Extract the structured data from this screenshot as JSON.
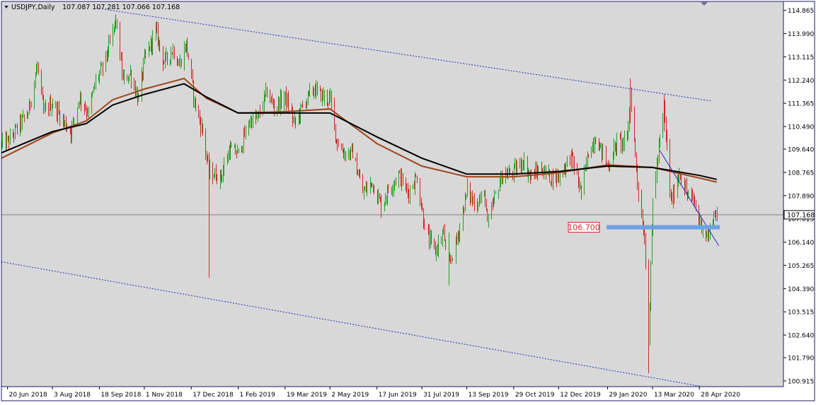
{
  "colors": {
    "background": "#d8d8d8",
    "axis_panel": "#ffffff",
    "frame": "#1b1b6b",
    "bull_candle": "#22a322",
    "bear_candle": "#d32626",
    "ma_black": "#000000",
    "ma_brown": "#a0461a",
    "channel_line": "#1f2fbf",
    "support_zone": "#6ea0e6",
    "current_price_line": "#808080",
    "price_tag_bg": "#ffffff",
    "price_label_text": "#d32626"
  },
  "chart_data": {
    "type": "candlestick",
    "title": "USDJPY,Daily",
    "ohlc_header": "107.087 107.281 107.066 107.168",
    "symbol": "USDJPY",
    "timeframe": "Daily",
    "ylim": [
      100.7,
      115.2
    ],
    "y_ticks": [
      "114.865",
      "113.990",
      "113.115",
      "112.240",
      "111.365",
      "110.490",
      "109.640",
      "108.765",
      "107.890",
      "107.015",
      "106.140",
      "105.265",
      "104.390",
      "103.515",
      "102.640",
      "101.790",
      "100.915"
    ],
    "x_ticks": [
      "20 Jun 2018",
      "3 Aug 2018",
      "18 Sep 2018",
      "1 Nov 2018",
      "17 Dec 2018",
      "1 Feb 2019",
      "19 Mar 2019",
      "2 May 2019",
      "17 Jun 2019",
      "31 Jul 2019",
      "13 Sep 2019",
      "29 Oct 2019",
      "12 Dec 2019",
      "29 Jan 2020",
      "13 Mar 2020",
      "28 Apr 2020"
    ],
    "x_tick_dates": [
      "2018-06-20",
      "2018-08-03",
      "2018-09-18",
      "2018-11-01",
      "2018-12-17",
      "2019-02-01",
      "2019-03-19",
      "2019-05-02",
      "2019-06-17",
      "2019-07-31",
      "2019-09-13",
      "2019-10-29",
      "2019-12-12",
      "2020-01-29",
      "2020-03-13",
      "2020-04-28"
    ],
    "current_price": 107.168,
    "current_price_label": "107.168",
    "support_level": 106.7,
    "support_label": "106.700",
    "price_path": [
      [
        "2018-06-14",
        109.8
      ],
      [
        "2018-06-22",
        110.0
      ],
      [
        "2018-07-02",
        110.6
      ],
      [
        "2018-07-10",
        111.0
      ],
      [
        "2018-07-19",
        112.8
      ],
      [
        "2018-07-25",
        111.0
      ],
      [
        "2018-08-03",
        111.4
      ],
      [
        "2018-08-13",
        110.7
      ],
      [
        "2018-08-21",
        110.3
      ],
      [
        "2018-08-29",
        111.6
      ],
      [
        "2018-09-07",
        111.0
      ],
      [
        "2018-09-14",
        112.2
      ],
      [
        "2018-09-21",
        112.7
      ],
      [
        "2018-09-28",
        113.6
      ],
      [
        "2018-10-04",
        114.5
      ],
      [
        "2018-10-11",
        112.2
      ],
      [
        "2018-10-18",
        112.5
      ],
      [
        "2018-10-26",
        111.5
      ],
      [
        "2018-11-01",
        113.0
      ],
      [
        "2018-11-12",
        114.1
      ],
      [
        "2018-11-20",
        112.9
      ],
      [
        "2018-11-29",
        113.4
      ],
      [
        "2018-12-05",
        112.8
      ],
      [
        "2018-12-12",
        113.6
      ],
      [
        "2018-12-20",
        111.4
      ],
      [
        "2018-12-28",
        110.3
      ],
      [
        "2019-01-03",
        108.8
      ],
      [
        "2019-01-07",
        108.7
      ],
      [
        "2019-01-15",
        108.6
      ],
      [
        "2019-01-23",
        109.6
      ],
      [
        "2019-02-01",
        109.5
      ],
      [
        "2019-02-12",
        110.7
      ],
      [
        "2019-02-20",
        110.8
      ],
      [
        "2019-03-01",
        111.8
      ],
      [
        "2019-03-08",
        111.2
      ],
      [
        "2019-03-19",
        111.6
      ],
      [
        "2019-03-28",
        110.6
      ],
      [
        "2019-04-08",
        111.5
      ],
      [
        "2019-04-16",
        111.9
      ],
      [
        "2019-04-25",
        111.6
      ],
      [
        "2019-05-02",
        111.5
      ],
      [
        "2019-05-08",
        110.0
      ],
      [
        "2019-05-15",
        109.5
      ],
      [
        "2019-05-24",
        109.5
      ],
      [
        "2019-06-03",
        108.0
      ],
      [
        "2019-06-12",
        108.4
      ],
      [
        "2019-06-21",
        107.5
      ],
      [
        "2019-06-28",
        108.1
      ],
      [
        "2019-07-08",
        108.7
      ],
      [
        "2019-07-17",
        108.0
      ],
      [
        "2019-07-26",
        108.6
      ],
      [
        "2019-08-01",
        107.0
      ],
      [
        "2019-08-07",
        106.2
      ],
      [
        "2019-08-13",
        105.8
      ],
      [
        "2019-08-21",
        106.5
      ],
      [
        "2019-08-26",
        105.2
      ],
      [
        "2019-09-03",
        106.2
      ],
      [
        "2019-09-13",
        108.1
      ],
      [
        "2019-09-20",
        107.6
      ],
      [
        "2019-10-01",
        107.9
      ],
      [
        "2019-10-03",
        106.7
      ],
      [
        "2019-10-10",
        107.8
      ],
      [
        "2019-10-17",
        108.6
      ],
      [
        "2019-10-29",
        108.8
      ],
      [
        "2019-11-07",
        109.2
      ],
      [
        "2019-11-14",
        108.6
      ],
      [
        "2019-11-25",
        108.9
      ],
      [
        "2019-12-03",
        108.6
      ],
      [
        "2019-12-12",
        108.6
      ],
      [
        "2019-12-24",
        109.4
      ],
      [
        "2020-01-03",
        108.0
      ],
      [
        "2020-01-10",
        109.5
      ],
      [
        "2020-01-17",
        110.1
      ],
      [
        "2020-01-29",
        109.0
      ],
      [
        "2020-02-07",
        109.9
      ],
      [
        "2020-02-17",
        109.9
      ],
      [
        "2020-02-20",
        111.8
      ],
      [
        "2020-02-28",
        108.0
      ],
      [
        "2020-03-05",
        106.3
      ],
      [
        "2020-03-09",
        102.5
      ],
      [
        "2020-03-13",
        107.8
      ],
      [
        "2020-03-24",
        111.2
      ],
      [
        "2020-03-31",
        107.6
      ],
      [
        "2020-04-08",
        108.8
      ],
      [
        "2020-04-16",
        107.9
      ],
      [
        "2020-04-22",
        107.7
      ],
      [
        "2020-04-28",
        106.9
      ],
      [
        "2020-05-06",
        106.3
      ],
      [
        "2020-05-12",
        107.2
      ],
      [
        "2020-05-15",
        107.168
      ]
    ],
    "ma_black": [
      [
        "2018-06-14",
        109.5
      ],
      [
        "2018-08-03",
        110.3
      ],
      [
        "2018-09-05",
        110.6
      ],
      [
        "2018-10-01",
        111.3
      ],
      [
        "2018-11-01",
        111.7
      ],
      [
        "2018-12-10",
        112.1
      ],
      [
        "2019-01-01",
        111.6
      ],
      [
        "2019-02-01",
        111.0
      ],
      [
        "2019-03-19",
        111.0
      ],
      [
        "2019-05-02",
        111.0
      ],
      [
        "2019-06-17",
        110.1
      ],
      [
        "2019-07-31",
        109.3
      ],
      [
        "2019-09-13",
        108.7
      ],
      [
        "2019-10-29",
        108.7
      ],
      [
        "2019-12-12",
        108.8
      ],
      [
        "2020-01-29",
        109.0
      ],
      [
        "2020-03-13",
        108.95
      ],
      [
        "2020-04-28",
        108.65
      ],
      [
        "2020-05-15",
        108.5
      ]
    ],
    "ma_brown": [
      [
        "2018-06-14",
        109.3
      ],
      [
        "2018-08-03",
        110.25
      ],
      [
        "2018-09-05",
        110.7
      ],
      [
        "2018-10-01",
        111.5
      ],
      [
        "2018-11-01",
        111.9
      ],
      [
        "2018-12-10",
        112.3
      ],
      [
        "2019-01-01",
        111.55
      ],
      [
        "2019-02-01",
        111.0
      ],
      [
        "2019-03-19",
        111.05
      ],
      [
        "2019-05-02",
        111.15
      ],
      [
        "2019-06-17",
        109.85
      ],
      [
        "2019-07-31",
        109.0
      ],
      [
        "2019-09-13",
        108.6
      ],
      [
        "2019-10-29",
        108.6
      ],
      [
        "2019-12-12",
        108.75
      ],
      [
        "2020-01-29",
        109.05
      ],
      [
        "2020-03-13",
        108.95
      ],
      [
        "2020-04-28",
        108.55
      ],
      [
        "2020-05-15",
        108.4
      ]
    ],
    "upper_channel": [
      [
        "2018-09-15",
        114.95
      ],
      [
        "2020-05-10",
        111.45
      ]
    ],
    "lower_channel": [
      [
        "2018-06-14",
        105.4
      ],
      [
        "2020-05-01",
        100.7
      ]
    ],
    "trend_line": [
      [
        "2020-03-20",
        109.6
      ],
      [
        "2020-05-17",
        106.0
      ]
    ],
    "support_zone_span": [
      [
        "2020-01-28",
        106.7
      ],
      [
        "2020-05-18",
        106.7
      ]
    ]
  }
}
